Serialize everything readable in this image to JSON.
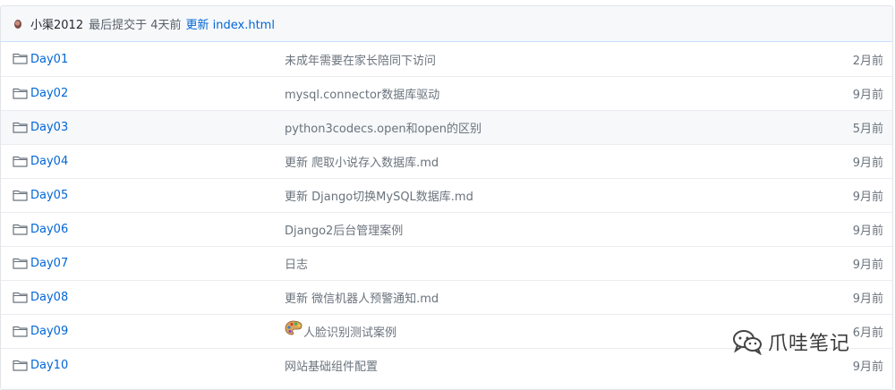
{
  "commit": {
    "author": "小渠2012",
    "meta": "最后提交于 4天前",
    "message": "更新 index.html"
  },
  "files": [
    {
      "name": "Day01",
      "message": "未成年需要在家长陪同下访问",
      "age": "2月前"
    },
    {
      "name": "Day02",
      "message": "mysql.connector数据库驱动",
      "age": "9月前"
    },
    {
      "name": "Day03",
      "message": "python3codecs.open和open的区别",
      "age": "5月前"
    },
    {
      "name": "Day04",
      "message": "更新 爬取小说存入数据库.md",
      "age": "9月前"
    },
    {
      "name": "Day05",
      "message": "更新 Django切换MySQL数据库.md",
      "age": "9月前"
    },
    {
      "name": "Day06",
      "message": "Django2后台管理案例",
      "age": "9月前"
    },
    {
      "name": "Day07",
      "message": "日志",
      "age": "9月前"
    },
    {
      "name": "Day08",
      "message": "更新 微信机器人预警通知.md",
      "age": "9月前"
    },
    {
      "name": "Day09",
      "message": "人脸识别测试案例",
      "age": "6月前",
      "icon": "palette-icon"
    },
    {
      "name": "Day10",
      "message": "网站基础组件配置",
      "age": "9月前"
    }
  ],
  "watermark": {
    "text": "爪哇笔记",
    "icon": "wechat-icon"
  },
  "colors": {
    "link": "#0366d6",
    "muted": "#6a737d",
    "border": "#eaecef",
    "header_bg": "#f6f8fa"
  }
}
